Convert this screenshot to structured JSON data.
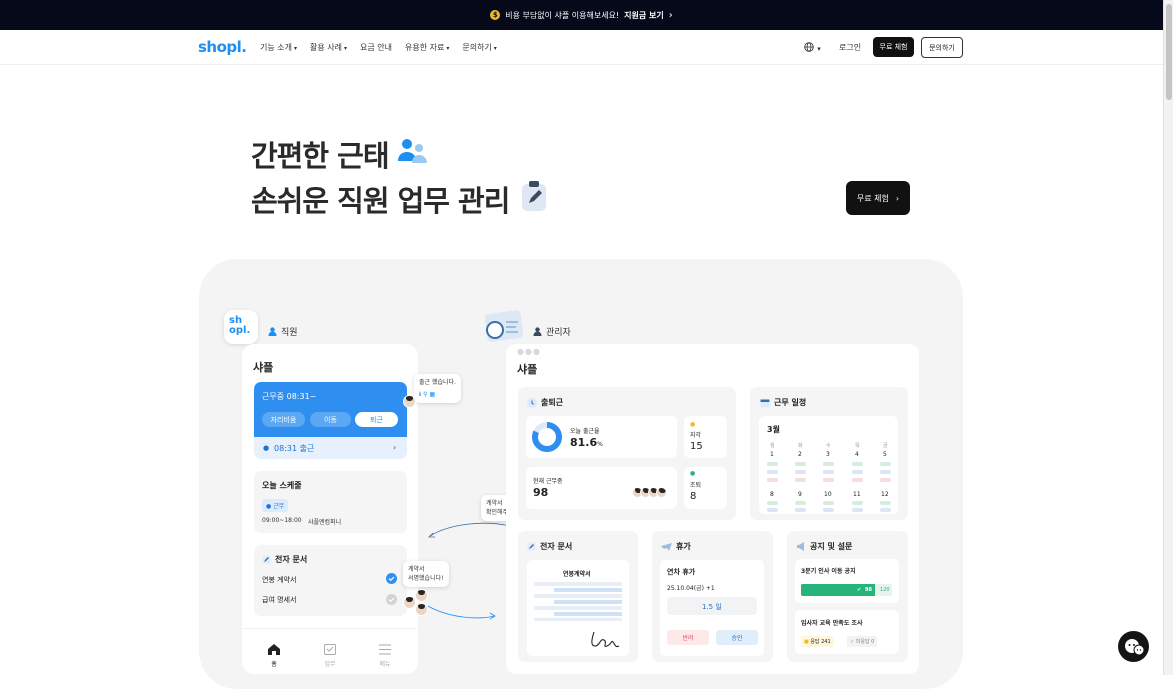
{
  "topbar": {
    "coin_icon": "$",
    "text": "비용 부담없이 샤플 이용해보세요!",
    "link": "지원금 보기",
    "arrow": "›"
  },
  "nav": {
    "logo": "shopl.",
    "menu": [
      {
        "label": "기능 소개",
        "caret": "▾"
      },
      {
        "label": "활용 사례",
        "caret": "▾"
      },
      {
        "label": "요금 안내",
        "caret": ""
      },
      {
        "label": "유용한 자료",
        "caret": "▾"
      },
      {
        "label": "문의하기",
        "caret": "▾"
      }
    ],
    "globe_caret": "▾",
    "login": "로그인",
    "trial": "무료 체험",
    "inquiry": "문의하기"
  },
  "hero": {
    "line1": "간편한 근태",
    "line2": "손쉬운 직원 업무 관리",
    "cta": "무료 체험",
    "cta_arrow": "›"
  },
  "employee": {
    "section_label": "직원",
    "app_icon": "sh\nopl.",
    "app_title": "샤플",
    "status": "근무중 08:31~",
    "buttons": [
      "자리비움",
      "이동",
      "퇴근"
    ],
    "checkin": "08:31 출근",
    "checkin_arrow": "›",
    "bubble1": "출근 했습니다.",
    "schedule_title": "오늘 스케줄",
    "schedule_tag": "● 근무",
    "schedule_time": "09:00~18:00",
    "schedule_place": "샤플엔컴퍼니",
    "doc_title": "전자 문서",
    "doc_items": [
      "연봉 계약서",
      "급여 명세서"
    ],
    "bubble2": "계약서\n서명했습니다!",
    "bubble3": "계약서\n확인해주세요.",
    "tabs": [
      "홈",
      "업무",
      "메뉴"
    ]
  },
  "admin": {
    "section_label": "관리자",
    "app_title": "샤플",
    "attendance": {
      "title": "출퇴근",
      "rate_label": "오늘 출근율",
      "rate": "81.6",
      "rate_unit": "%",
      "rate_value": 81.6,
      "working_label": "현재 근무중",
      "working": "98",
      "late_label": "지각",
      "late": "15",
      "early_label": "조퇴",
      "early": "8"
    },
    "schedule": {
      "title": "근무 일정",
      "month": "3월",
      "weekdays": [
        "월",
        "화",
        "수",
        "목",
        "금"
      ],
      "week1": [
        "1",
        "2",
        "3",
        "4",
        "5"
      ],
      "week2": [
        "8",
        "9",
        "10",
        "11",
        "12"
      ]
    },
    "docs": {
      "title": "전자 문서",
      "doc_name": "연봉계약서"
    },
    "leave": {
      "title": "휴가",
      "type": "연차 휴가",
      "date": "25.10.04(금) +1",
      "days": "1.5 일",
      "reject": "반려",
      "approve": "승인"
    },
    "notice": {
      "title": "공지 및 설문",
      "notice_title": "3분기 인사 이동 공지",
      "read": "98",
      "total": "120",
      "survey_title": "임사자 교육 만족도 조사",
      "response": "응답 241",
      "undone": "미응답 0"
    }
  },
  "colors": {
    "brand": "#1e8ff0",
    "dark": "#05091a",
    "green": "#26b47a"
  }
}
